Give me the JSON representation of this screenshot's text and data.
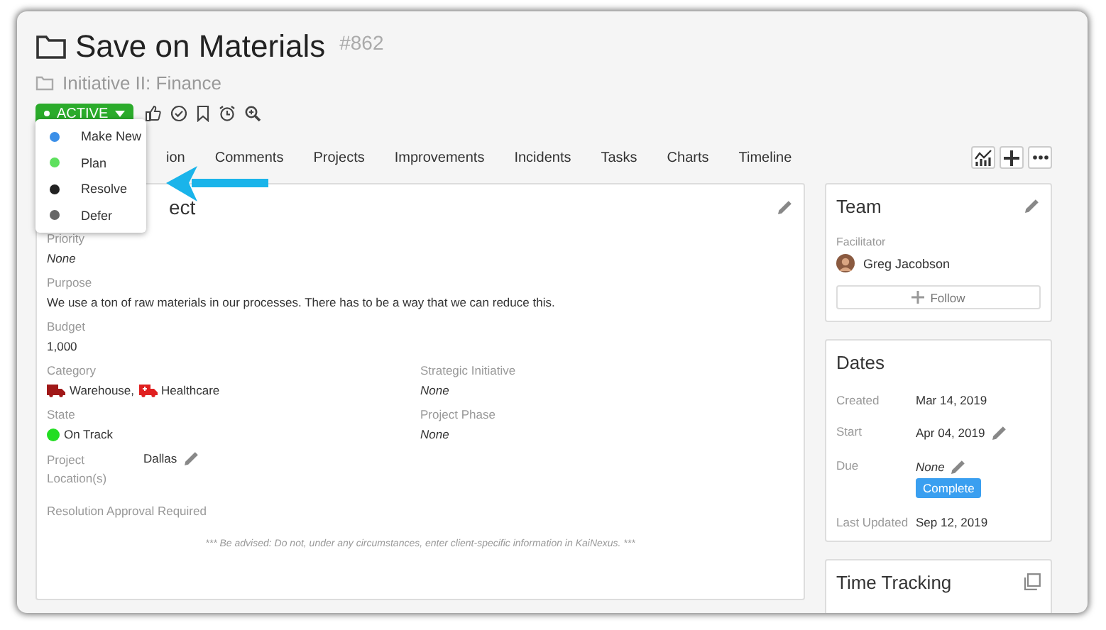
{
  "header": {
    "title": "Save on Materials",
    "number": "#862",
    "parent": "Initiative II: Finance"
  },
  "status": {
    "label": "ACTIVE",
    "expanded": true
  },
  "status_menu": [
    {
      "label": "Make New",
      "color": "#3b8fe8"
    },
    {
      "label": "Plan",
      "color": "#5ee05e"
    },
    {
      "label": "Resolve",
      "color": "#222222"
    },
    {
      "label": "Defer",
      "color": "#666666"
    }
  ],
  "tabs": [
    {
      "label": "ion"
    },
    {
      "label": "Comments"
    },
    {
      "label": "Projects"
    },
    {
      "label": "Improvements"
    },
    {
      "label": "Incidents"
    },
    {
      "label": "Tasks"
    },
    {
      "label": "Charts"
    },
    {
      "label": "Timeline"
    }
  ],
  "main_card": {
    "title": "ect",
    "rows": [
      [
        {
          "label": "Priority",
          "kind": "none",
          "value": "None"
        }
      ],
      [
        {
          "label": "Purpose",
          "kind": "text",
          "value": "We use a ton of raw materials in our processes. There has to be a way that we can reduce this."
        }
      ],
      [
        {
          "label": "Budget",
          "kind": "text",
          "value": "1,000"
        }
      ],
      [
        {
          "label": "Category",
          "kind": "tags",
          "tags": [
            {
              "label": "Warehouse,",
              "color": "#a01818"
            },
            {
              "label": "Healthcare",
              "color": "#e02020"
            }
          ]
        },
        {
          "label": "Strategic Initiative",
          "kind": "none",
          "value": "None"
        }
      ],
      [
        {
          "label": "State",
          "kind": "status",
          "value": "On Track",
          "color": "#22dd22"
        },
        {
          "label": "Project Phase",
          "kind": "none",
          "value": "None"
        }
      ],
      [
        {
          "label": "Project Location(s)",
          "kind": "location",
          "value": "Dallas"
        }
      ],
      [
        {
          "label": "Resolution Approval Required",
          "kind": "label"
        }
      ]
    ],
    "note": "*** Be advised: Do not, under any circumstances, enter client-specific information in KaiNexus. ***"
  },
  "team": {
    "title": "Team",
    "role": "Facilitator",
    "person": "Greg Jacobson",
    "follow": "Follow"
  },
  "dates": {
    "title": "Dates",
    "rows": [
      {
        "label": "Created",
        "value": "Mar 14, 2019",
        "italic": false,
        "editable": false
      },
      {
        "label": "Start",
        "value": "Apr 04, 2019",
        "italic": false,
        "editable": true
      },
      {
        "label": "Due",
        "value": "None",
        "italic": true,
        "editable": true,
        "badge": "Complete"
      },
      {
        "label": "Last Updated",
        "value": "Sep 12, 2019",
        "italic": false,
        "editable": false
      }
    ]
  },
  "time_tracking": {
    "title": "Time Tracking"
  }
}
